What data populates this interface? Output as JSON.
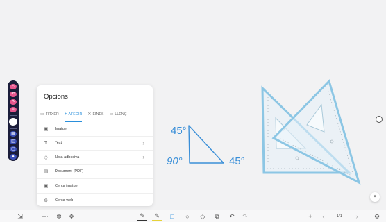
{
  "panel": {
    "title": "Opcions",
    "tabs": [
      {
        "icon": "folder-icon",
        "glyph": "▭",
        "label": "FITXER"
      },
      {
        "icon": "plus-icon",
        "glyph": "+",
        "label": "AFEGIR"
      },
      {
        "icon": "tools-icon",
        "glyph": "✕",
        "label": "EINES"
      },
      {
        "icon": "canvas-icon",
        "glyph": "▭",
        "label": "LLENÇ"
      }
    ],
    "items": [
      {
        "icon": "image-icon",
        "glyph": "▣",
        "label": "Imatge"
      },
      {
        "icon": "text-icon",
        "glyph": "T",
        "label": "Text",
        "has_submenu": true
      },
      {
        "icon": "sticky-note-icon",
        "glyph": "◇",
        "label": "Nota adhesiva",
        "has_submenu": true
      },
      {
        "icon": "document-icon",
        "glyph": "▤",
        "label": "Document (PDF)"
      },
      {
        "icon": "image-search-icon",
        "glyph": "▣",
        "label": "Cerca imatge"
      },
      {
        "icon": "globe-icon",
        "glyph": "⊕",
        "label": "Cerca web"
      }
    ]
  },
  "whiteboard": {
    "angle_top": "45°",
    "angle_left": "90°",
    "angle_right": "45°"
  },
  "toolbar": {
    "page_indicator": "1/1"
  },
  "colors": {
    "accent": "#2a8fdb",
    "ink": "#3a8fd8",
    "left_bar": "#1b1d3a"
  }
}
